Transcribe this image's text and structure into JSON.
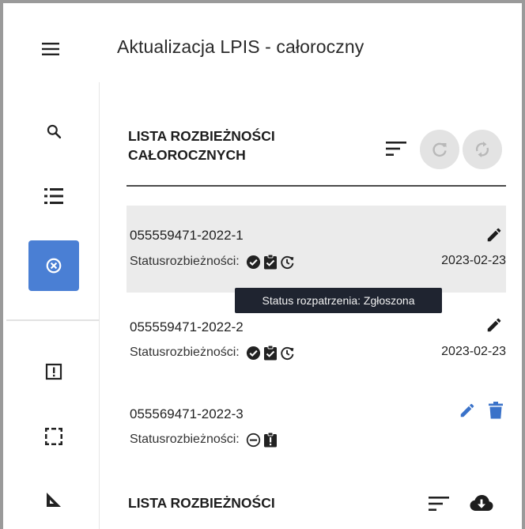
{
  "app": {
    "title": "Aktualizacja LPIS - całoroczny"
  },
  "sidebar": {
    "items": [
      {
        "name": "search",
        "icon": "search-icon"
      },
      {
        "name": "list",
        "icon": "list-icon"
      },
      {
        "name": "discrepancies",
        "icon": "cancel-circle-icon",
        "active": true
      },
      {
        "name": "alert",
        "icon": "alert-box-icon"
      },
      {
        "name": "select-area",
        "icon": "selection-icon"
      },
      {
        "name": "measure",
        "icon": "set-square-icon"
      }
    ]
  },
  "section_annual": {
    "title_line1": "LISTA ROZBIEŻNOŚCI",
    "title_line2": "CAŁOROCZNYCH",
    "items": [
      {
        "id": "055559471-2022-1",
        "status_label": "Statusrozbieżności:",
        "date": "2023-02-23"
      },
      {
        "id": "055559471-2022-2",
        "status_label": "Statusrozbieżności:",
        "date": "2023-02-23"
      },
      {
        "id": "055569471-2022-3",
        "status_label": "Statusrozbieżności:",
        "date": ""
      }
    ]
  },
  "tooltip": {
    "text": "Status rozpatrzenia: Zgłoszona"
  },
  "section_list": {
    "title": "LISTA ROZBIEŻNOŚCI"
  },
  "colors": {
    "accent": "#4a7fd4",
    "edit_blue": "#3a72c9",
    "dark": "#1d1d1d",
    "tooltip_bg": "#1f2430",
    "highlight": "#ebebeb"
  }
}
